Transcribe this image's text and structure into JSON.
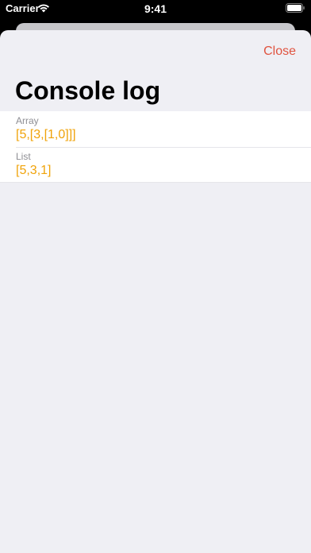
{
  "status_bar": {
    "carrier": "Carrier",
    "time": "9:41",
    "wifi_icon": "wifi-icon",
    "battery_icon": "battery-icon"
  },
  "header": {
    "close_label": "Close",
    "title": "Console log",
    "close_color": "#e0533f"
  },
  "log": {
    "value_color": "#f0a30a",
    "items": [
      {
        "label": "Array",
        "value": "[5,[3,[1,0]]]"
      },
      {
        "label": "List",
        "value": "[5,3,1]"
      }
    ]
  }
}
